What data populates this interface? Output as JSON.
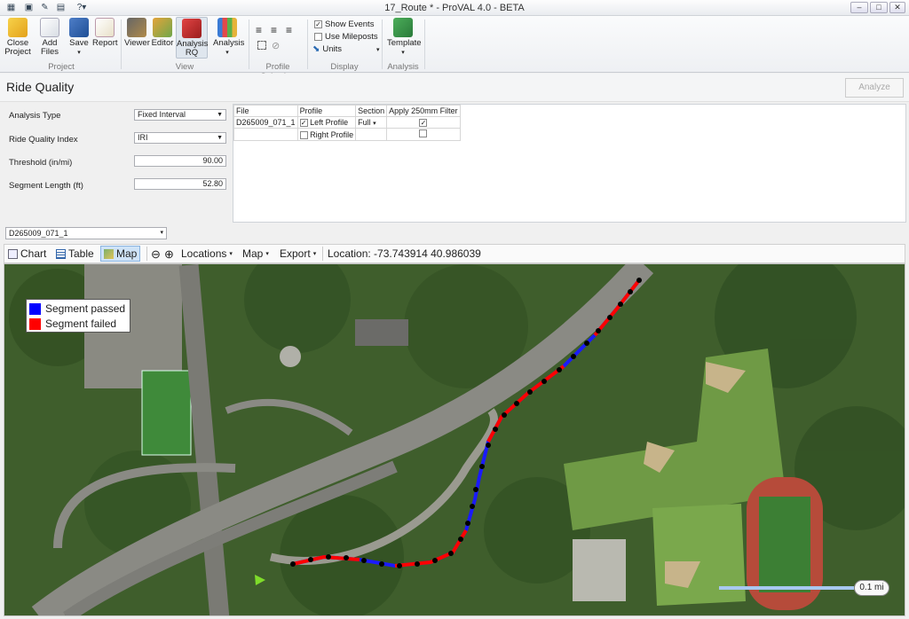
{
  "window": {
    "title": "17_Route * - ProVAL 4.0 - BETA"
  },
  "ribbon": {
    "close_project": "Close Project",
    "add_files": "Add Files",
    "save": "Save",
    "report": "Report",
    "viewer": "Viewer",
    "editor": "Editor",
    "analysis_rq": "Analysis RQ",
    "analysis": "Analysis",
    "show_events": "Show Events",
    "use_mileposts": "Use Mileposts",
    "units": "Units",
    "template": "Template",
    "groups": {
      "project": "Project",
      "view": "View",
      "profile_selection": "Profile Selection",
      "display": "Display",
      "analysis": "Analysis"
    }
  },
  "rq": {
    "title": "Ride Quality",
    "analyze": "Analyze",
    "analysis_type_label": "Analysis Type",
    "analysis_type_value": "Fixed Interval",
    "ride_index_label": "Ride Quality Index",
    "ride_index_value": "IRI",
    "threshold_label": "Threshold (in/mi)",
    "threshold_value": "90.00",
    "segment_label": "Segment Length (ft)",
    "segment_value": "52.80"
  },
  "grid": {
    "headers": [
      "File",
      "Profile",
      "Section",
      "Apply 250mm Filter"
    ],
    "file": "D265009_071_1",
    "left_profile": "Left Profile",
    "right_profile": "Right Profile",
    "section": "Full"
  },
  "record_select": "D265009_071_1",
  "toolbar": {
    "chart": "Chart",
    "table": "Table",
    "map": "Map",
    "locations": "Locations",
    "map_menu": "Map",
    "export": "Export",
    "location": "Location: -73.743914 40.986039"
  },
  "map": {
    "legend_passed": "Segment passed",
    "legend_failed": "Segment failed",
    "scale": "0.1 mi",
    "passed_color": "#0000ff",
    "failed_color": "#ff0000"
  }
}
